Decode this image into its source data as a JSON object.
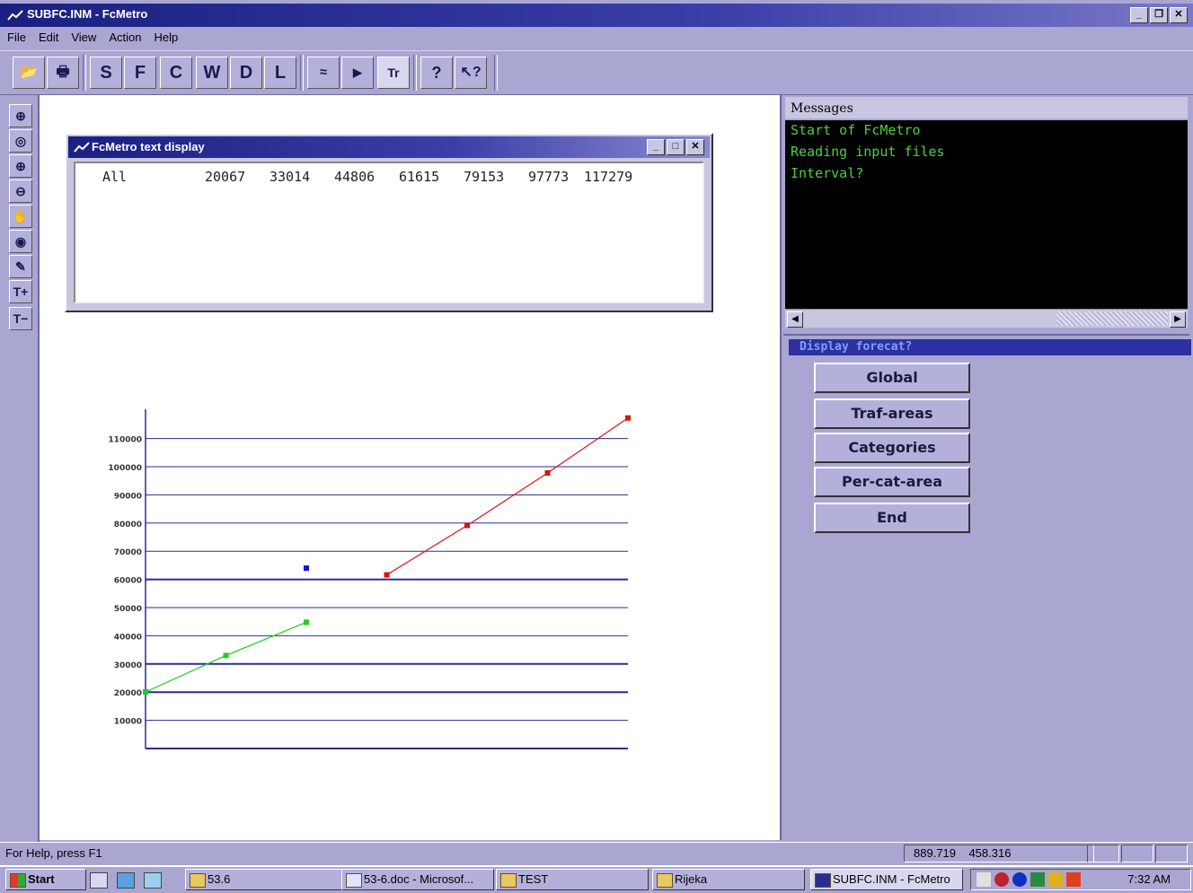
{
  "window": {
    "title": "SUBFC.INM - FcMetro"
  },
  "menu": [
    "File",
    "Edit",
    "View",
    "Action",
    "Help"
  ],
  "toolbar": {
    "letters": [
      "S",
      "F",
      "C",
      "W",
      "D",
      "L"
    ]
  },
  "text_display": {
    "title": "FcMetro text display",
    "row_label": "All",
    "row_values": [
      "20067",
      "33014",
      "44806",
      "61615",
      "79153",
      "97773",
      "117279"
    ]
  },
  "messages": {
    "header": "Messages",
    "lines": [
      "Start of FcMetro",
      "Reading input files",
      "Interval?"
    ]
  },
  "forecast": {
    "header": "Display forecat?",
    "buttons": [
      "Global",
      "Traf-areas",
      "Categories",
      "Per-cat-area",
      "End"
    ]
  },
  "status": {
    "help": "For Help, press F1",
    "coord_x": "889.719",
    "coord_y": "458.316"
  },
  "taskbar": {
    "start": "Start",
    "tasks": [
      "53.6",
      "53-6.doc - Microsof...",
      "TEST",
      "Rijeka",
      "SUBFC.INM - FcMetro"
    ],
    "clock": "7:32 AM"
  },
  "colors": {
    "series_green": "#22cc22",
    "series_blue": "#1010e0",
    "series_red": "#dd1111",
    "grid": "#2a2a9a"
  },
  "chart_data": {
    "type": "line",
    "title": "",
    "xlabel": "",
    "ylabel": "",
    "ylim": [
      0,
      120000
    ],
    "y_ticks": [
      "10000",
      "20000",
      "30000",
      "40000",
      "50000",
      "60000",
      "70000",
      "80000",
      "90000",
      "100000",
      "110000"
    ],
    "series": [
      {
        "color": "#22cc22",
        "points": [
          [
            0,
            20067
          ],
          [
            1,
            33014
          ],
          [
            2,
            44806
          ]
        ]
      },
      {
        "color": "#1010e0",
        "points": [
          [
            2,
            64000
          ]
        ]
      },
      {
        "color": "#dd1111",
        "points": [
          [
            3,
            61615
          ],
          [
            4,
            79153
          ],
          [
            5,
            97773
          ],
          [
            6,
            117279
          ]
        ]
      }
    ]
  }
}
